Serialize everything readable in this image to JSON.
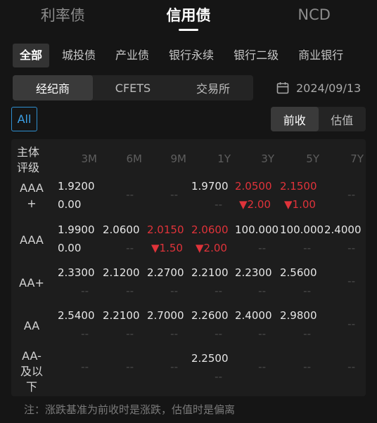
{
  "top_tabs": [
    {
      "label": "利率债",
      "active": false
    },
    {
      "label": "信用债",
      "active": true
    },
    {
      "label": "NCD",
      "active": false
    }
  ],
  "categories": [
    "全部",
    "城投债",
    "产业债",
    "银行永续",
    "银行二级",
    "商业银行"
  ],
  "active_category": "全部",
  "sources": [
    "经纪商",
    "CFETS",
    "交易所"
  ],
  "active_source": "经纪商",
  "date": "2024/09/13",
  "all_label": "All",
  "modes": [
    "前收",
    "估值"
  ],
  "active_mode": "前收",
  "table": {
    "rating_header": "主体\n评级",
    "tenors": [
      "3M",
      "6M",
      "9M",
      "1Y",
      "3Y",
      "5Y",
      "7Y"
    ],
    "rows": [
      {
        "rating": "AAA\n+",
        "cells": [
          {
            "v": "1.9200",
            "c": "0.00"
          },
          {
            "v": "--",
            "c": ""
          },
          {
            "v": "--",
            "c": ""
          },
          {
            "v": "1.9700",
            "c": "--"
          },
          {
            "v": "2.0500",
            "c": "▼2.00",
            "red": true
          },
          {
            "v": "2.1500",
            "c": "▼1.00",
            "red": true
          },
          {
            "v": "--",
            "c": ""
          }
        ]
      },
      {
        "rating": "AAA",
        "cells": [
          {
            "v": "1.9900",
            "c": "0.00"
          },
          {
            "v": "2.0600",
            "c": "--"
          },
          {
            "v": "2.0150",
            "c": "▼1.50",
            "red": true
          },
          {
            "v": "2.0600",
            "c": "▼2.00",
            "red": true
          },
          {
            "v": "100.000",
            "c": "--"
          },
          {
            "v": "100.000",
            "c": "--"
          },
          {
            "v": "2.4000",
            "c": "--"
          }
        ]
      },
      {
        "rating": "AA+",
        "cells": [
          {
            "v": "2.3300",
            "c": "--"
          },
          {
            "v": "2.1200",
            "c": "--"
          },
          {
            "v": "2.2700",
            "c": "--"
          },
          {
            "v": "2.2100",
            "c": "--"
          },
          {
            "v": "2.2300",
            "c": "--"
          },
          {
            "v": "2.5600",
            "c": "--"
          },
          {
            "v": "--",
            "c": ""
          }
        ]
      },
      {
        "rating": "AA",
        "cells": [
          {
            "v": "2.5400",
            "c": "--"
          },
          {
            "v": "2.2100",
            "c": "--"
          },
          {
            "v": "2.7000",
            "c": "--"
          },
          {
            "v": "2.2600",
            "c": "--"
          },
          {
            "v": "2.4000",
            "c": "--"
          },
          {
            "v": "2.9800",
            "c": "--"
          },
          {
            "v": "--",
            "c": ""
          }
        ]
      },
      {
        "rating": "AA-\n及以\n下",
        "cells": [
          {
            "v": "--",
            "c": ""
          },
          {
            "v": "--",
            "c": ""
          },
          {
            "v": "--",
            "c": ""
          },
          {
            "v": "2.2500",
            "c": "--"
          },
          {
            "v": "--",
            "c": ""
          },
          {
            "v": "--",
            "c": ""
          },
          {
            "v": "--",
            "c": ""
          }
        ]
      }
    ]
  },
  "note": "注：涨跌基准为前收时是涨跌，估值时是偏离",
  "colors": {
    "accent": "#2f8fd0",
    "down": "#e0333a",
    "background": "#151515"
  },
  "icons": {
    "date": "calendar-icon"
  }
}
